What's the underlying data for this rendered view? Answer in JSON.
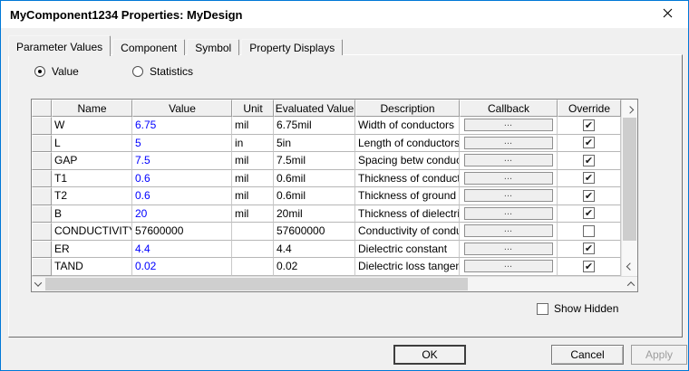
{
  "window": {
    "title": "MyComponent1234 Properties: MyDesign"
  },
  "tabs": [
    {
      "label": "Parameter Values",
      "active": true
    },
    {
      "label": "Component",
      "active": false
    },
    {
      "label": "Symbol",
      "active": false
    },
    {
      "label": "Property Displays",
      "active": false
    }
  ],
  "mode": {
    "options": [
      {
        "label": "Value",
        "selected": true
      },
      {
        "label": "Statistics",
        "selected": false
      }
    ]
  },
  "table": {
    "columns": [
      "",
      "Name",
      "Value",
      "Unit",
      "Evaluated Value",
      "Description",
      "Callback",
      "Override"
    ],
    "rows": [
      {
        "name": "W",
        "value": "6.75",
        "value_blue": true,
        "unit": "mil",
        "evaluated": "6.75mil",
        "description": "Width of conductors",
        "callback": "...",
        "override": true
      },
      {
        "name": "L",
        "value": "5",
        "value_blue": true,
        "unit": "in",
        "evaluated": "5in",
        "description": "Length of conductors",
        "callback": "...",
        "override": true
      },
      {
        "name": "GAP",
        "value": "7.5",
        "value_blue": true,
        "unit": "mil",
        "evaluated": "7.5mil",
        "description": "Spacing betw conduct...",
        "callback": "...",
        "override": true
      },
      {
        "name": "T1",
        "value": "0.6",
        "value_blue": true,
        "unit": "mil",
        "evaluated": "0.6mil",
        "description": "Thickness of conductors",
        "callback": "...",
        "override": true
      },
      {
        "name": "T2",
        "value": "0.6",
        "value_blue": true,
        "unit": "mil",
        "evaluated": "0.6mil",
        "description": "Thickness of ground la...",
        "callback": "...",
        "override": true
      },
      {
        "name": "B",
        "value": "20",
        "value_blue": true,
        "unit": "mil",
        "evaluated": "20mil",
        "description": "Thickness of dielectric l...",
        "callback": "...",
        "override": true
      },
      {
        "name": "CONDUCTIVITY",
        "value": "57600000",
        "value_blue": false,
        "unit": "",
        "evaluated": "57600000",
        "description": "Conductivity of conduc...",
        "callback": "...",
        "override": false
      },
      {
        "name": "ER",
        "value": "4.4",
        "value_blue": true,
        "unit": "",
        "evaluated": "4.4",
        "description": "Dielectric constant",
        "callback": "...",
        "override": true
      },
      {
        "name": "TAND",
        "value": "0.02",
        "value_blue": true,
        "unit": "",
        "evaluated": "0.02",
        "description": "Dielectric loss tangent",
        "callback": "...",
        "override": true
      }
    ],
    "checkmark": "✔"
  },
  "show_hidden": {
    "label": "Show Hidden",
    "checked": false
  },
  "footer_buttons": [
    {
      "label": "OK",
      "default": true,
      "disabled": false
    },
    {
      "label": "Cancel",
      "default": false,
      "disabled": false
    },
    {
      "label": "Apply",
      "default": false,
      "disabled": true
    }
  ],
  "colors": {
    "frame_accent": "#0078d7",
    "value_text": "#0000ff"
  }
}
